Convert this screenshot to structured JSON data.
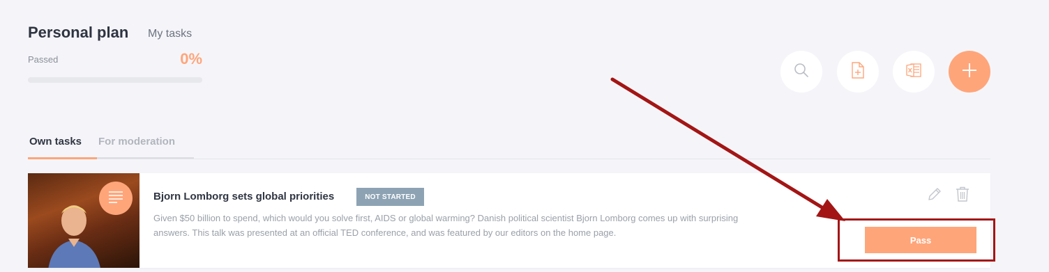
{
  "header": {
    "title": "Personal plan",
    "subtitle": "My tasks"
  },
  "progress": {
    "label": "Passed",
    "value_text": "0%",
    "fraction": 0
  },
  "toolbar": {
    "search_icon": "search-icon",
    "doc_icon": "add-document-icon",
    "excel_icon": "excel-icon",
    "add_icon": "plus-icon"
  },
  "tabs": [
    {
      "label": "Own tasks",
      "active": true
    },
    {
      "label": "For moderation",
      "active": false
    }
  ],
  "task": {
    "title": "Bjorn Lomborg sets global priorities",
    "status": "NOT STARTED",
    "description": "Given $50 billion to spend, which would you solve first, AIDS or global warming? Danish political scientist Bjorn Lomborg comes up with surprising answers. This talk was presented at an official TED conference, and was featured by our editors on the home page.",
    "pass_label": "Pass",
    "type_icon": "text-lines-icon"
  },
  "colors": {
    "accent": "#ffa57a",
    "status_badge": "#8da3b4",
    "annotation": "#a31515"
  }
}
